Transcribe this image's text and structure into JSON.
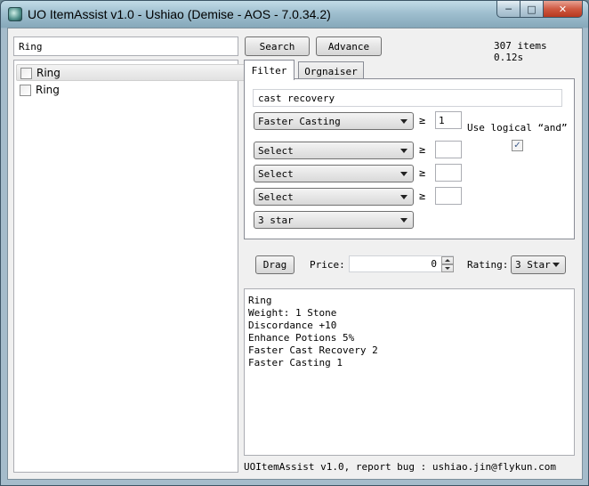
{
  "window": {
    "title": "UO ItemAssist v1.0 - Ushiao (Demise - AOS - 7.0.34.2)",
    "minimize_glyph": "─",
    "maximize_glyph": "□",
    "close_glyph": "✕"
  },
  "search": {
    "value": "Ring",
    "search_label": "Search",
    "advance_label": "Advance",
    "result_info": "307 items 0.12s"
  },
  "items": [
    {
      "label": "Ring",
      "checked": false,
      "selected": true
    },
    {
      "label": "Ring",
      "checked": false,
      "selected": false
    }
  ],
  "tabs": [
    {
      "label": "Filter",
      "active": true
    },
    {
      "label": "Orgnaiser",
      "active": false
    }
  ],
  "filter": {
    "keyword": "cast recovery",
    "ge_symbol": "≥",
    "rows": [
      {
        "property": "Faster Casting",
        "value": "1"
      },
      {
        "property": "Select",
        "value": ""
      },
      {
        "property": "Select",
        "value": ""
      },
      {
        "property": "Select",
        "value": ""
      }
    ],
    "star_select": "3 star",
    "logical_and_label": "Use logical “and”",
    "logical_and_checked": true,
    "check_glyph": "✓"
  },
  "actions": {
    "drag_label": "Drag",
    "price_label": "Price:",
    "price_value": "0",
    "rating_label": "Rating:",
    "rating_value": "3 Star"
  },
  "details": {
    "lines": [
      "Ring",
      "Weight: 1 Stone",
      "Discordance +10",
      "Enhance Potions 5%",
      "Faster Cast Recovery 2",
      "Faster Casting 1"
    ]
  },
  "status": {
    "text": "UOItemAssist v1.0, report bug : ushiao.jin@flykun.com"
  }
}
